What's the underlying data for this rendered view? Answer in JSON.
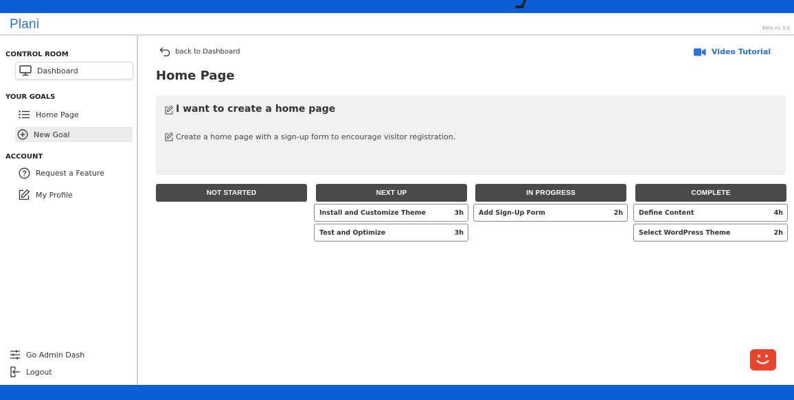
{
  "app": {
    "logo": "Plani",
    "version": "Beta v1.3.0"
  },
  "sidebar": {
    "control_room_label": "CONTROL ROOM",
    "dashboard_label": "Dashboard",
    "your_goals_label": "YOUR GOALS",
    "goals": [
      {
        "label": "Home Page"
      }
    ],
    "new_goal_label": "New Goal",
    "account_label": "ACCOUNT",
    "request_feature_label": "Request a Feature",
    "my_profile_label": "My Profile",
    "admin_dash_label": "Go Admin Dash",
    "logout_label": "Logout"
  },
  "main": {
    "back_label": "back to Dashboard",
    "video_label": "Video Tutorial",
    "page_title": "Home Page",
    "goal": {
      "heading": "I want to create a home page",
      "description": "Create a home page with a sign-up form to encourage visitor registration."
    },
    "columns": [
      {
        "title": "NOT STARTED",
        "tasks": []
      },
      {
        "title": "NEXT UP",
        "tasks": [
          {
            "name": "Install and Customize Theme",
            "estimate": "3h"
          },
          {
            "name": "Test and Optimize",
            "estimate": "3h"
          }
        ]
      },
      {
        "title": "IN PROGRESS",
        "tasks": [
          {
            "name": "Add Sign-Up Form",
            "estimate": "2h"
          }
        ]
      },
      {
        "title": "COMPLETE",
        "tasks": [
          {
            "name": "Define Content",
            "estimate": "4h"
          },
          {
            "name": "Select WordPress Theme",
            "estimate": "2h"
          }
        ]
      }
    ]
  },
  "colors": {
    "brand": "#2b6fdc",
    "column_header": "#4a4a4a",
    "chat": "#e8452b",
    "background": "#0a5fd6"
  },
  "icons": [
    "monitor-icon",
    "list-icon",
    "plus-circle-icon",
    "question-circle-icon",
    "edit-icon",
    "sliders-icon",
    "logout-icon",
    "back-arrow-icon",
    "video-camera-icon",
    "pencil-icon",
    "chat-face-icon"
  ]
}
